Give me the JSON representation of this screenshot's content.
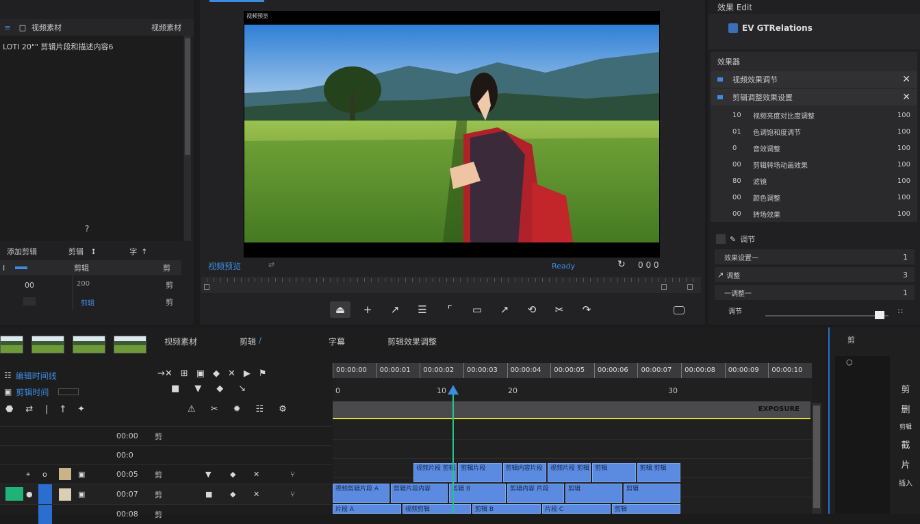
{
  "left_panel": {
    "title": "视频素材",
    "title_right": "视频素材",
    "line1": "LOTI 20\"\" 剪辑片段和描述内容6",
    "center_icon": "?",
    "toolbar": {
      "a": "添加剪辑",
      "b": "剪辑",
      "c": "字"
    },
    "table": {
      "headers": [
        "I",
        "剪辑",
        "剪"
      ],
      "rows": [
        [
          "00",
          "200",
          "剪"
        ],
        [
          "",
          "剪辑",
          "剪"
        ]
      ]
    }
  },
  "preview": {
    "title": "视频预览",
    "label_left": "视频预览",
    "label_mid": "Ready",
    "label_right": "0 0 0"
  },
  "right_panel": {
    "header": "效果 Edit",
    "asset_name": "EV GTRelations",
    "section_title": "效果器",
    "items_top": [
      "视频效果调节",
      "剪辑调整效果设置"
    ],
    "items": [
      {
        "num": "10",
        "label": "视频亮度对比度调整",
        "val": "100"
      },
      {
        "num": "01",
        "label": "色调饱和度调节",
        "val": "100"
      },
      {
        "num": "0",
        "label": "音效调整",
        "val": "100"
      },
      {
        "num": "00",
        "label": "剪辑转场动画效果",
        "val": "100"
      },
      {
        "num": "80",
        "label": "滤镜",
        "val": "100"
      },
      {
        "num": "00",
        "label": "颜色调整",
        "val": "100"
      },
      {
        "num": "00",
        "label": "转场效果",
        "val": "100"
      }
    ],
    "section2_title": "调节",
    "items2": [
      {
        "label": "效果设置一",
        "val": "1"
      },
      {
        "label": "调整",
        "val": "3"
      },
      {
        "label": "一调整一",
        "val": "1"
      }
    ],
    "slider_label": "调节"
  },
  "timeline": {
    "tabs": [
      "视频素材",
      "剪辑",
      "字幕",
      "剪辑效果调整"
    ],
    "tab_active_suffix": "/",
    "track_header1": "编辑时间线",
    "track_header2": "剪辑时间",
    "ruler_ticks": [
      "00:00:00",
      "00:00:01",
      "00:00:02",
      "00:00:03",
      "00:00:04",
      "00:00:05",
      "00:00:06",
      "00:00:07",
      "00:00:08",
      "00:00:09",
      "00:00:10"
    ],
    "markers": [
      "0",
      "10",
      "20",
      "30"
    ],
    "playhead_clip_label": "EXPOSURE",
    "track_rows": [
      {
        "time": "00:00",
        "icon": "剪"
      },
      {
        "time": "00:0",
        "icon": ""
      },
      {
        "time": "00:05",
        "icon": "剪"
      },
      {
        "time": "00:07",
        "icon": "剪"
      },
      {
        "time": "00:08",
        "icon": "剪"
      }
    ],
    "clip_row1": [
      "视频片段 剪辑 剪辑",
      "剪辑片段",
      "剪辑内容片段",
      "视频片段 剪辑",
      "剪辑",
      "剪辑 剪辑"
    ],
    "clip_row2": [
      "视频剪辑片段 A",
      "剪辑片段内容",
      "剪辑 B",
      "剪辑内容 片段",
      "剪辑",
      "剪辑"
    ],
    "clip_row3": [
      "片段 A",
      "视频剪辑",
      "剪辑 B",
      "片段 C",
      "剪辑"
    ]
  },
  "right_tools": {
    "header": "剪",
    "items": [
      "剪",
      "删",
      "剪辑",
      "截",
      "片",
      "插入"
    ]
  }
}
